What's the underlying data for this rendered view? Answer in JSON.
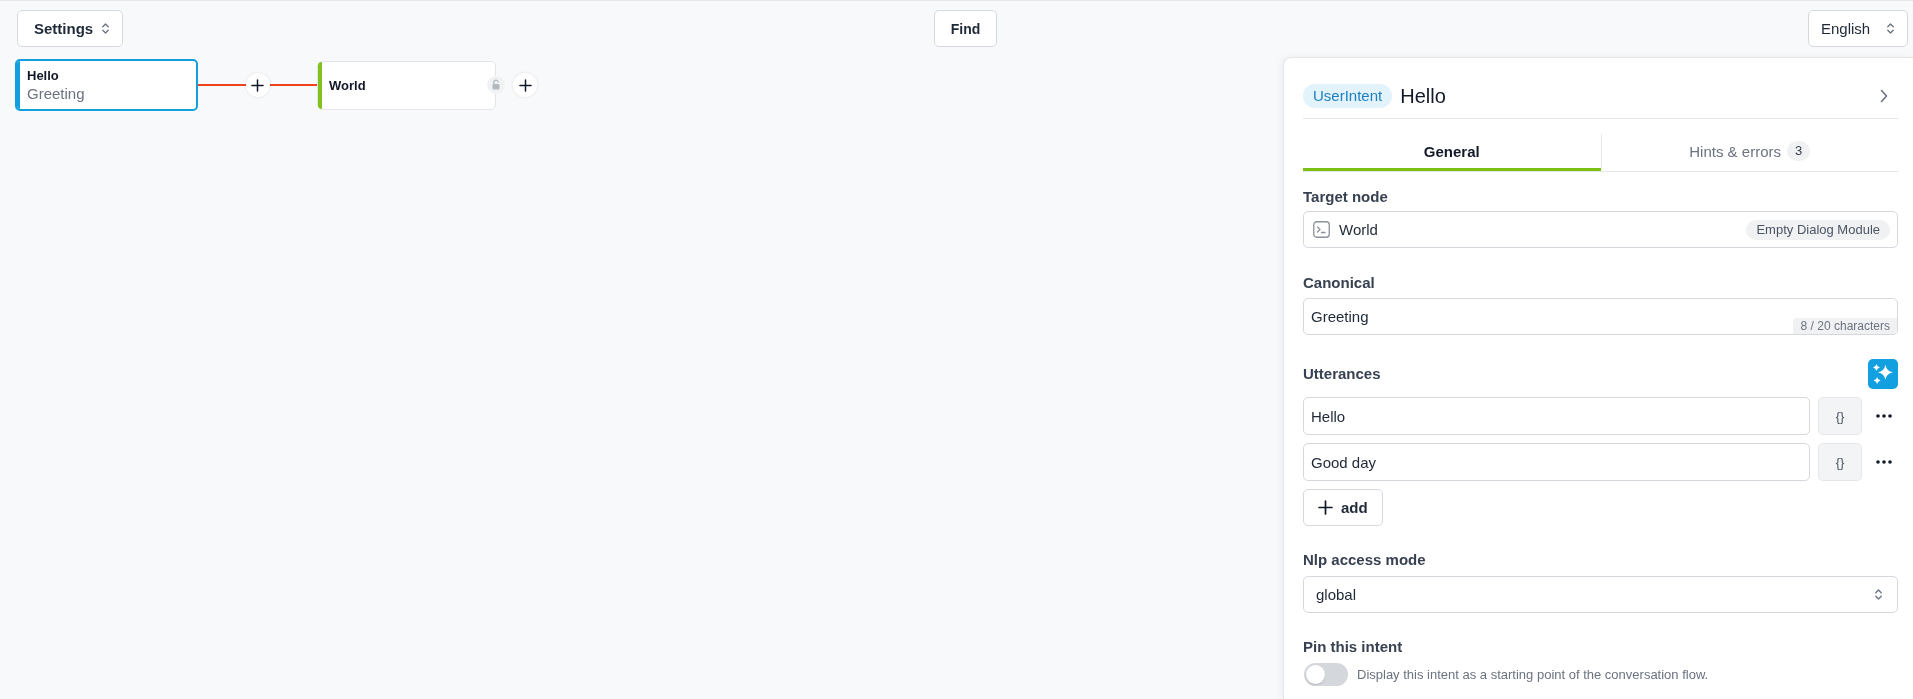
{
  "toolbar": {
    "settings_select": {
      "value": "Settings"
    },
    "find_button": "Find",
    "language_select": {
      "value": "English"
    }
  },
  "canvas": {
    "nodes": [
      {
        "title": "Hello",
        "subtitle": "Greeting",
        "color": "#129fe0",
        "selected": true,
        "locked": false,
        "children": [
          {
            "title": "World",
            "color": "#7fc31c",
            "selected": false,
            "locked": true
          }
        ]
      }
    ]
  },
  "panel": {
    "badge": "UserIntent",
    "title": "Hello",
    "tabs": [
      {
        "label": "General",
        "selected": true
      },
      {
        "label": "Hints & errors",
        "count": "3",
        "selected": false
      }
    ],
    "target_node": {
      "label": "Target node",
      "value": "World",
      "tag": "Empty Dialog Module"
    },
    "canonical": {
      "label": "Canonical",
      "value": "Greeting",
      "counter": "8 / 20 characters"
    },
    "utterances": {
      "label": "Utterances",
      "items": [
        {
          "value": "Hello",
          "variables_button": "{}"
        },
        {
          "value": "Good day",
          "variables_button": "{}"
        }
      ],
      "add_button": "add"
    },
    "nlp_access_mode": {
      "label": "Nlp access mode",
      "value": "global"
    },
    "pin": {
      "label": "Pin this intent",
      "on": false,
      "description": "Display this intent as a starting point of the conversation flow."
    }
  }
}
